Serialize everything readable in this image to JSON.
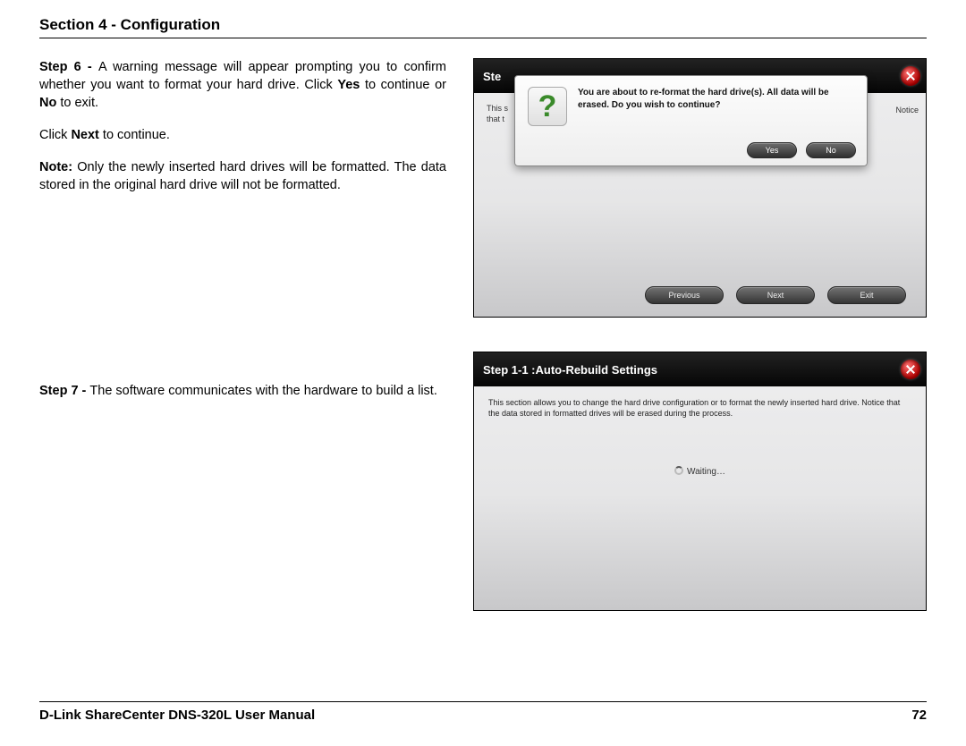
{
  "header": {
    "title": "Section 4 - Configuration"
  },
  "left": {
    "step6_label": "Step 6 - ",
    "step6_body": "A warning message will appear prompting you to confirm whether you want to format your hard drive. Click ",
    "yes": "Yes",
    "step6_tail": " to continue or ",
    "no": "No",
    "step6_tail2": " to exit.",
    "click_next": "Click ",
    "next_bold": "Next",
    "click_next_tail": " to continue.",
    "note_label": "Note:",
    "note_body": " Only the newly inserted hard drives will be formatted. The data stored in the original hard drive will not be formatted.",
    "step7_label": "Step 7 - ",
    "step7_body": "The software communicates with the hardware to build a list."
  },
  "ss1": {
    "title_fragment": "Ste",
    "bg_line1": "This s",
    "bg_line2": "that t",
    "dialog_text": "You are about to re-format the hard drive(s). All data will be erased. Do you wish to continue?",
    "yes": "Yes",
    "no": "No",
    "notice": "Notice",
    "prev": "Previous",
    "next": "Next",
    "exit": "Exit"
  },
  "ss2": {
    "title": "Step 1-1 :Auto-Rebuild Settings",
    "desc": "This section allows you to change the hard drive configuration or to format the newly inserted hard drive. Notice that the data stored in formatted drives will be erased during the process.",
    "waiting": "Waiting…"
  },
  "footer": {
    "manual": "D-Link ShareCenter DNS-320L User Manual",
    "page": "72"
  }
}
